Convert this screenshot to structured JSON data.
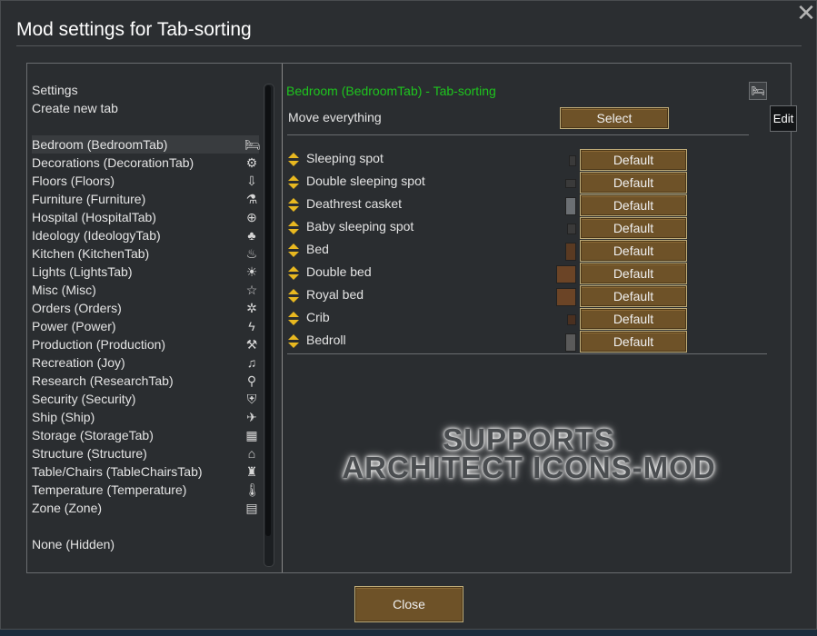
{
  "window": {
    "title": "Mod settings for Tab-sorting",
    "close_icon": "close-icon"
  },
  "sidebar": {
    "top_items": [
      {
        "label": "Settings"
      },
      {
        "label": "Create new tab"
      }
    ],
    "tabs": [
      {
        "label": "Bedroom (BedroomTab)",
        "icon": "bed-icon",
        "glyph": "🛏"
      },
      {
        "label": "Decorations (DecorationTab)",
        "icon": "gear-icon",
        "glyph": "⚙"
      },
      {
        "label": "Floors (Floors)",
        "icon": "floor-arrow-icon",
        "glyph": "⇩"
      },
      {
        "label": "Furniture (Furniture)",
        "icon": "lamp-icon",
        "glyph": "⚗"
      },
      {
        "label": "Hospital (HospitalTab)",
        "icon": "medical-cross-icon",
        "glyph": "⊕"
      },
      {
        "label": "Ideology (IdeologyTab)",
        "icon": "tree-icon",
        "glyph": "♣"
      },
      {
        "label": "Kitchen (KitchenTab)",
        "icon": "pot-icon",
        "glyph": "♨"
      },
      {
        "label": "Lights (LightsTab)",
        "icon": "lightbulb-icon",
        "glyph": "☀"
      },
      {
        "label": "Misc (Misc)",
        "icon": "star-icon",
        "glyph": "☆"
      },
      {
        "label": "Orders (Orders)",
        "icon": "cog-icon",
        "glyph": "✲"
      },
      {
        "label": "Power (Power)",
        "icon": "lightning-icon",
        "glyph": "ϟ"
      },
      {
        "label": "Production (Production)",
        "icon": "wrench-icon",
        "glyph": "⚒"
      },
      {
        "label": "Recreation (Joy)",
        "icon": "gamepad-icon",
        "glyph": "♫"
      },
      {
        "label": "Research (ResearchTab)",
        "icon": "microscope-icon",
        "glyph": "⚲"
      },
      {
        "label": "Security (Security)",
        "icon": "shield-icon",
        "glyph": "⛨"
      },
      {
        "label": "Ship (Ship)",
        "icon": "plane-icon",
        "glyph": "✈"
      },
      {
        "label": "Storage (StorageTab)",
        "icon": "shelf-icon",
        "glyph": "▦"
      },
      {
        "label": "Structure (Structure)",
        "icon": "house-icon",
        "glyph": "⌂"
      },
      {
        "label": "Table/Chairs (TableChairsTab)",
        "icon": "chair-icon",
        "glyph": "♜"
      },
      {
        "label": "Temperature (Temperature)",
        "icon": "thermometer-icon",
        "glyph": "🌡"
      },
      {
        "label": "Zone (Zone)",
        "icon": "map-icon",
        "glyph": "▤"
      }
    ],
    "hidden_item": {
      "label": "None (Hidden)"
    }
  },
  "main": {
    "header": "Bedroom (BedroomTab) - Tab-sorting",
    "header_icon": "bed-icon",
    "header_glyph": "🛏",
    "move_label": "Move everything",
    "select_label": "Select",
    "default_label": "Default",
    "items": [
      {
        "name": "Sleeping spot",
        "thumb_color": "#3a3a3a"
      },
      {
        "name": "Double sleeping spot",
        "thumb_color": "#3a3a3a"
      },
      {
        "name": "Deathrest casket",
        "thumb_color": "#6b6f73"
      },
      {
        "name": "Baby sleeping spot",
        "thumb_color": "#3a3a3a"
      },
      {
        "name": "Bed",
        "thumb_color": "#5a3a22"
      },
      {
        "name": "Double bed",
        "thumb_color": "#6b4426"
      },
      {
        "name": "Royal bed",
        "thumb_color": "#6b4426"
      },
      {
        "name": "Crib",
        "thumb_color": "#4a3020"
      },
      {
        "name": "Bedroll",
        "thumb_color": "#5a5a5a"
      }
    ]
  },
  "tooltip": {
    "label": "Edit"
  },
  "promo": {
    "line1": "SUPPORTS",
    "line2": "ARCHITECT ICONS-MOD"
  },
  "footer": {
    "close_label": "Close"
  }
}
